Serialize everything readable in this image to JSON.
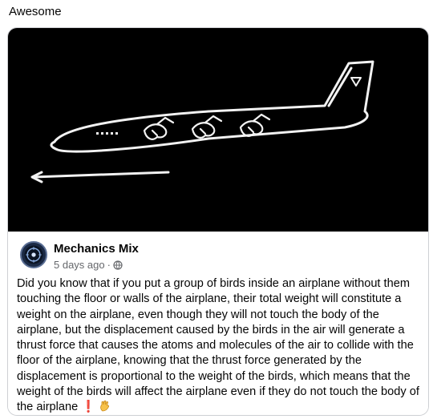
{
  "caption": "Awesome",
  "post": {
    "page_name": "Mechanics Mix",
    "time": "5 days ago",
    "separator": "·",
    "privacy_icon": "globe-icon",
    "body": "Did you know that if you put a group of birds inside an airplane without them touching the floor or walls of the airplane, their total weight will constitute a weight on the airplane, even though they will not touch the body of the airplane, but the displacement caused by the birds in the air will generate a thrust force that causes the atoms and molecules of the air to collide with the floor of the airplane, knowing that the thrust force generated by the displacement is proportional to the weight of the birds, which means that the weight of the birds will affect the airplane even if they do not touch the body of the airplane",
    "emoji_1": "❗",
    "emoji_2_icon": "ok-hand-icon"
  },
  "media": {
    "description_icon": "airplane-with-birds-drawing",
    "background": "#000000",
    "stroke": "#f2f2f2"
  },
  "colors": {
    "text": "#050505",
    "meta": "#65676b",
    "border": "#ced0d4"
  }
}
